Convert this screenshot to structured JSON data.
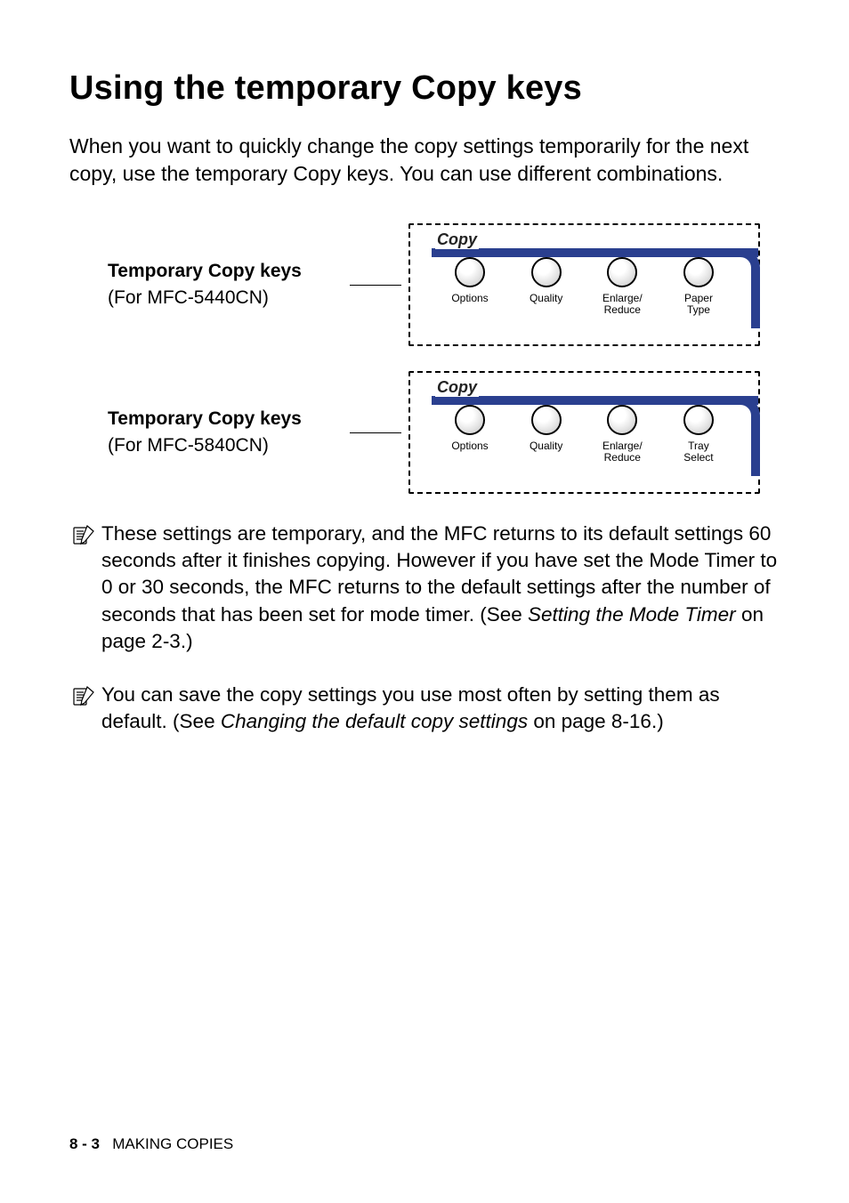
{
  "heading": "Using the temporary Copy keys",
  "intro": "When you want to quickly change the copy settings temporarily for the next copy, use the temporary Copy keys. You can use different combinations.",
  "keypanels": [
    {
      "title": "Temporary Copy keys",
      "sub": "(For MFC-5440CN)",
      "copy_label": "Copy",
      "buttons": [
        "Options",
        "Quality",
        "Enlarge/\nReduce",
        "Paper\nType"
      ]
    },
    {
      "title": "Temporary Copy keys",
      "sub": "(For MFC-5840CN)",
      "copy_label": "Copy",
      "buttons": [
        "Options",
        "Quality",
        "Enlarge/\nReduce",
        "Tray\nSelect"
      ]
    }
  ],
  "notes": [
    {
      "pre": "These settings are temporary, and the MFC returns to its default settings 60 seconds after it finishes copying. However if you have set the Mode Timer to 0 or 30 seconds, the MFC returns to the default settings after the number of seconds that has been set for mode timer. (See ",
      "link": "Setting the Mode Timer",
      "post": " on page 2-3.)"
    },
    {
      "pre": "You can save the copy settings you use most often by setting them as default. (See ",
      "link": "Changing the default copy settings",
      "post": " on page 8-16.)"
    }
  ],
  "footer": {
    "page": "8 - 3",
    "section": "MAKING COPIES"
  }
}
